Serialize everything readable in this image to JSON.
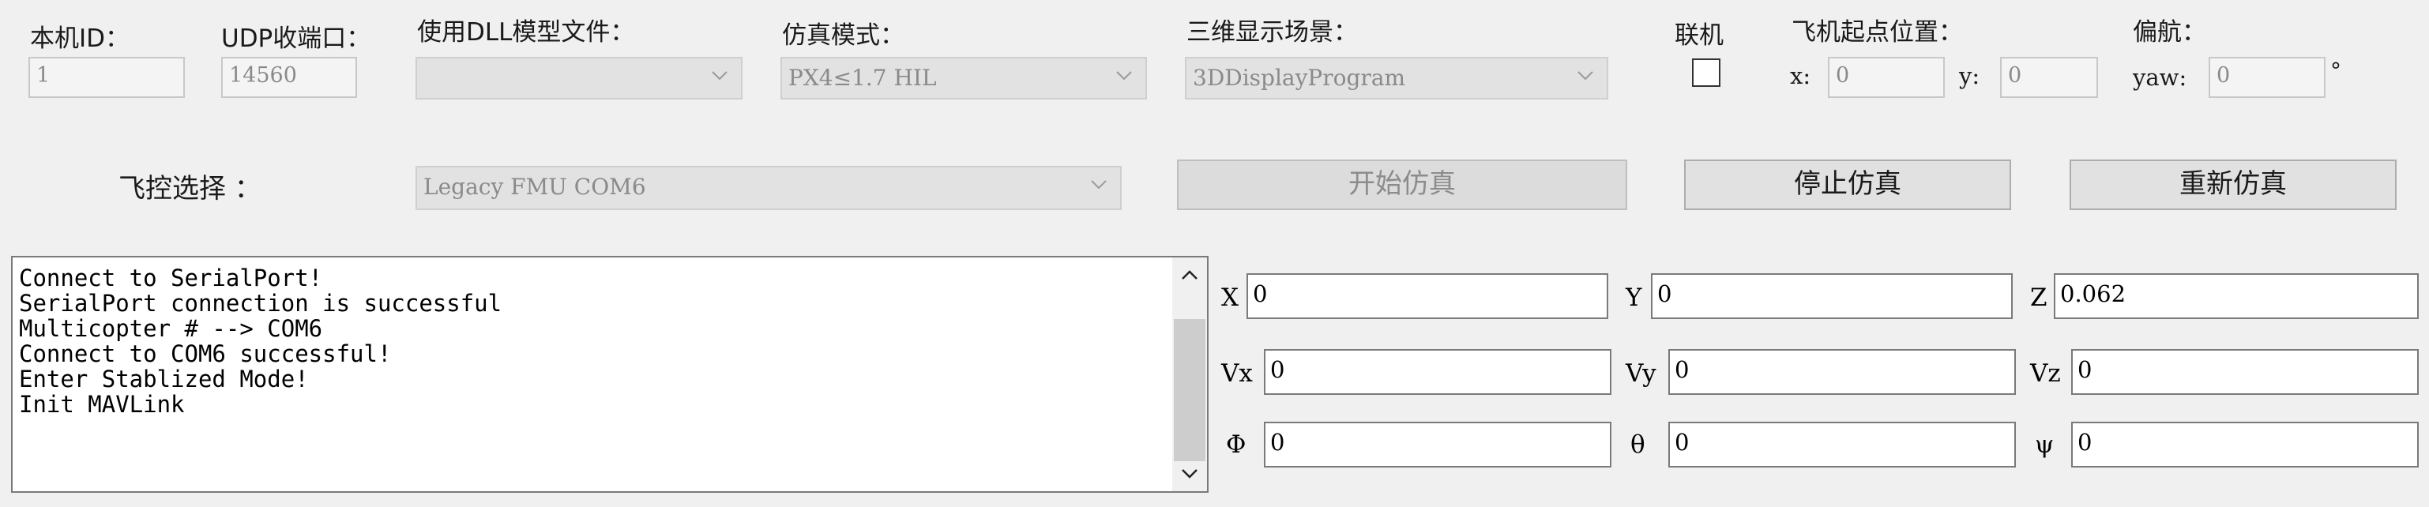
{
  "top": {
    "local_id": {
      "label": "本机ID：",
      "value": "1"
    },
    "udp_port": {
      "label": "UDP收端口：",
      "value": "14560"
    },
    "dll_model": {
      "label": "使用DLL模型文件：",
      "value": ""
    },
    "sim_mode": {
      "label": "仿真模式：",
      "value": "PX4≤1.7 HIL"
    },
    "scene": {
      "label": "三维显示场景：",
      "value": "3DDisplayProgram"
    },
    "link": {
      "label": "联机",
      "checked": false
    },
    "start_pos": {
      "label": "飞机起点位置：",
      "x_label": "x:",
      "x_value": "0",
      "y_label": "y:",
      "y_value": "0"
    },
    "yaw": {
      "label": "偏航：",
      "yaw_label": "yaw:",
      "yaw_value": "0",
      "unit": "°"
    }
  },
  "controller": {
    "label": "飞控选择 ：",
    "value": "Legacy FMU COM6",
    "start_button": "开始仿真",
    "stop_button": "停止仿真",
    "restart_button": "重新仿真"
  },
  "log": {
    "lines": [
      "Connect to SerialPort!",
      "SerialPort connection is successful",
      "Multicopter # --> COM6",
      "Connect to COM6 successful!",
      "Enter Stablized Mode!",
      "Init MAVLink"
    ]
  },
  "state": {
    "x": {
      "label": "X",
      "value": "0"
    },
    "y": {
      "label": "Y",
      "value": "0"
    },
    "z": {
      "label": "Z",
      "value": "0.062"
    },
    "vx": {
      "label": "Vx",
      "value": "0"
    },
    "vy": {
      "label": "Vy",
      "value": "0"
    },
    "vz": {
      "label": "Vz",
      "value": "0"
    },
    "phi": {
      "label": "Φ",
      "value": "0"
    },
    "theta": {
      "label": "θ",
      "value": "0"
    },
    "psi": {
      "label": "ψ",
      "value": "0"
    }
  },
  "icons": {
    "dropdown": "chevron-down-icon",
    "scroll_up": "chevron-up-icon",
    "scroll_down": "chevron-down-icon"
  }
}
